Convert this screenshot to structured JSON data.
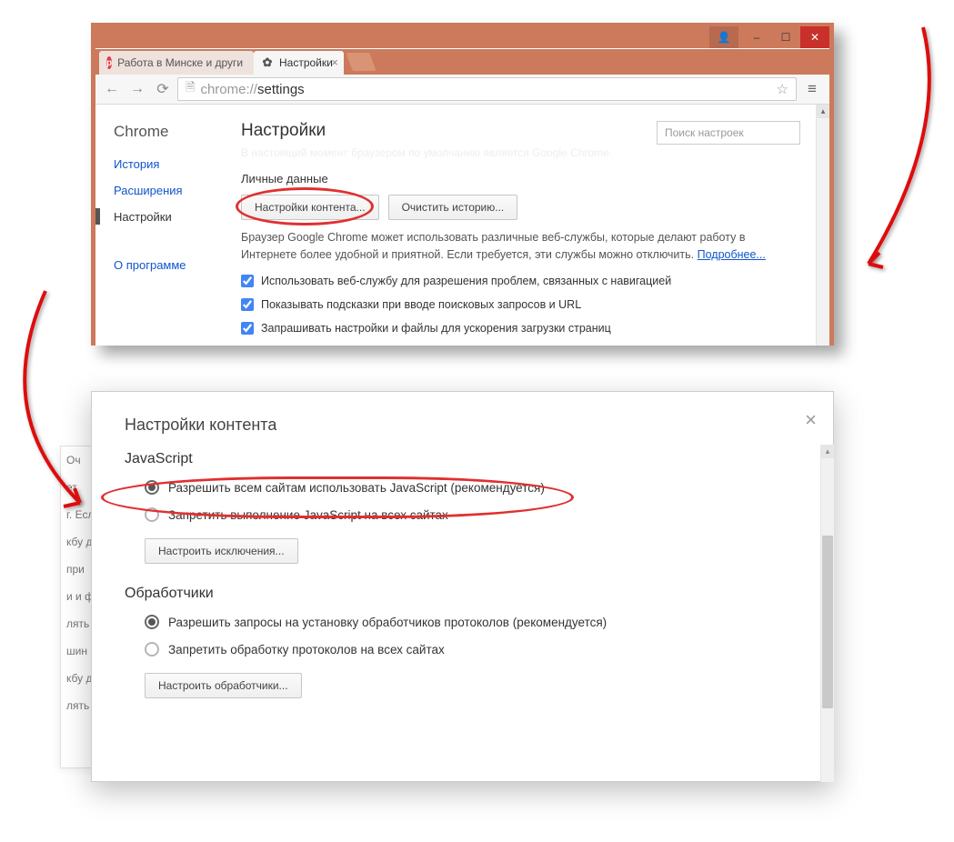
{
  "window_controls": {
    "user": "👤",
    "min": "–",
    "max": "☐",
    "close": "✕"
  },
  "tabs": [
    {
      "label": "Работа в Минске и други",
      "icon": "p"
    },
    {
      "label": "Настройки",
      "icon": "gear"
    }
  ],
  "address": {
    "host": "chrome://",
    "path": "settings"
  },
  "sidebar": {
    "brand": "Chrome",
    "items": [
      "История",
      "Расширения",
      "Настройки"
    ],
    "about": "О программе"
  },
  "main": {
    "heading": "Настройки",
    "faint": "В настоящий момент браузером по умолчанию является Google Chrome.",
    "search_placeholder": "Поиск настроек",
    "privacy_heading": "Личные данные",
    "btn_content": "Настройки контента...",
    "btn_clear": "Очистить историю...",
    "desc_pre": "Браузер Google Chrome может использовать различные веб-службы, которые делают работу в Интернете более удобной и приятной. Если требуется, эти службы можно отключить. ",
    "desc_link": "Подробнее...",
    "checks": [
      "Использовать веб-службу для разрешения проблем, связанных с навигацией",
      "Показывать подсказки при вводе поисковых запросов и URL",
      "Запрашивать настройки и файлы для ускорения загрузки страниц"
    ]
  },
  "bg_fragments": [
    "Оч",
    "ет",
    "г. Есл",
    "кбу д",
    "при ",
    "и и ф",
    "лять ",
    "шин",
    "кбу д",
    "лять "
  ],
  "dialog": {
    "title": "Настройки контента",
    "js_heading": "JavaScript",
    "js_allow": "Разрешить всем сайтам использовать JavaScript (рекомендуется)",
    "js_block": "Запретить выполнение JavaScript на всех сайтах",
    "js_exceptions": "Настроить исключения...",
    "handlers_heading": "Обработчики",
    "handlers_allow": "Разрешить запросы на установку обработчиков протоколов (рекомендуется)",
    "handlers_block": "Запретить обработку протоколов на всех сайтах",
    "handlers_btn": "Настроить обработчики..."
  }
}
